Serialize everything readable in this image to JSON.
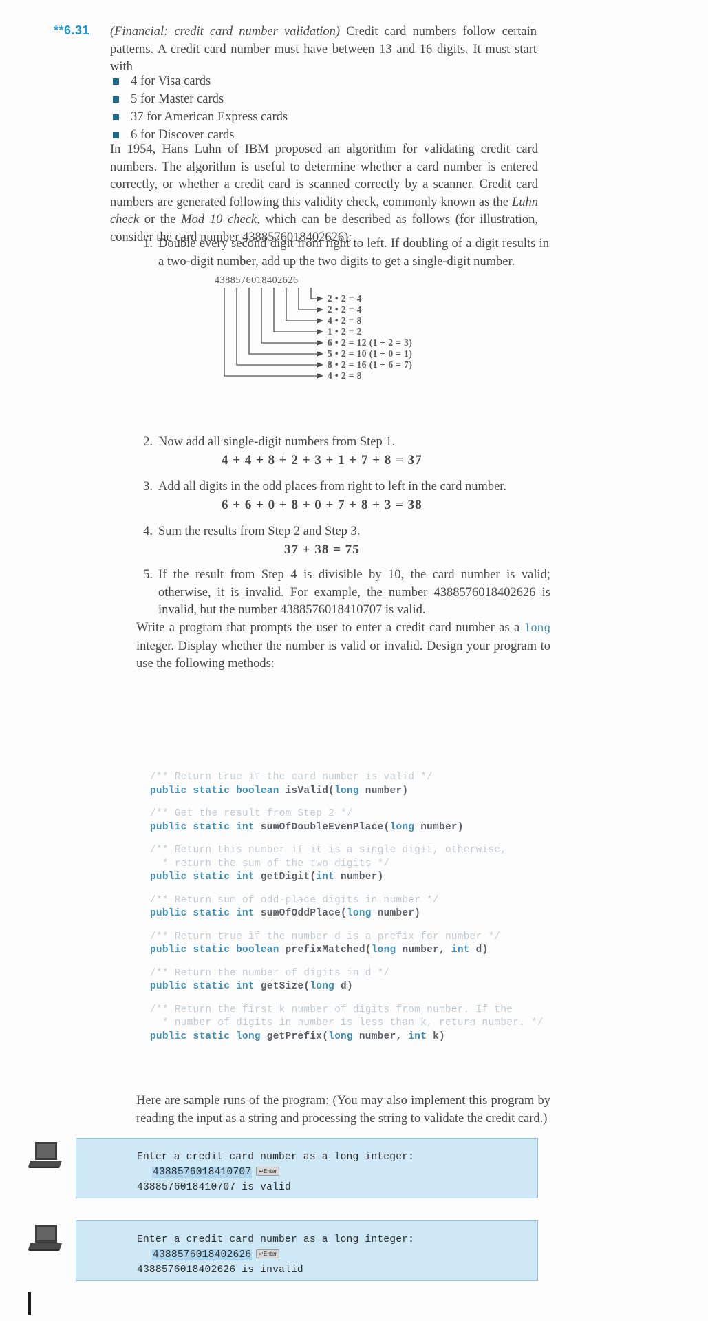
{
  "exercise": {
    "number": "**6.31",
    "title_italic": "(Financial: credit card number validation)",
    "intro": " Credit card numbers follow certain patterns. A credit card number must have between 13 and 16 digits. It must start with",
    "bullets": [
      "4 for Visa cards",
      "5 for Master cards",
      "37 for American Express cards",
      "6 for Discover cards"
    ],
    "paragraph2_a": "In 1954, Hans Luhn of IBM proposed an algorithm for validating credit card numbers. The algorithm is useful to determine whether a card number is entered correctly, or whether a credit card is scanned correctly by a scanner. Credit card numbers are generated following this validity check, commonly known as the ",
    "paragraph2_italic1": "Luhn check",
    "paragraph2_b": " or the ",
    "paragraph2_italic2": "Mod 10 check,",
    "paragraph2_c": " which can be described as follows (for illustration, consider the card number 4388576018402626):"
  },
  "steps": [
    {
      "number": "1.",
      "text": "Double every second digit from right to left. If doubling of a digit results in a two-digit number, add up the two digits to get a single-digit number."
    },
    {
      "number": "2.",
      "text": "Now add all single-digit numbers from Step 1.",
      "equation": "4 + 4 + 8 + 2 + 3 + 1 + 7 + 8 = 37"
    },
    {
      "number": "3.",
      "text": "Add all digits in the odd places from right to left in the card number.",
      "equation": "6 + 6 + 0 + 8 + 0 + 7 + 8 + 3 = 38"
    },
    {
      "number": "4.",
      "text": "Sum the results from Step 2 and Step 3.",
      "equation": "37 + 38 = 75"
    },
    {
      "number": "5.",
      "text": "If the result from Step 4 is divisible by 10, the card number is valid; otherwise, it is invalid. For example, the number 4388576018402626 is invalid, but the number 4388576018410707 is valid."
    }
  ],
  "diagram": {
    "card_number": "4388576018402626",
    "rows": [
      "2 • 2 = 4",
      "2 • 2 = 4",
      "4 • 2 = 8",
      "1 • 2 = 2",
      "6 • 2 = 12  (1 + 2 = 3)",
      "5 • 2 = 10  (1 + 0 = 1)",
      "8 • 2 = 16  (1 + 6 = 7)",
      "4 • 2 = 8"
    ]
  },
  "write_program": {
    "a": "Write a program that prompts the user to enter a credit card number as a ",
    "keyword": "long",
    "b": " integer. Display whether the number is valid or invalid. Design your program to use the following methods:"
  },
  "code": [
    {
      "comment": "/** Return true if the card number is valid */",
      "signature": [
        {
          "t": "public static boolean ",
          "k": true
        },
        {
          "t": "isValid(",
          "k": false
        },
        {
          "t": "long ",
          "k": true
        },
        {
          "t": "number)",
          "k": false
        }
      ]
    },
    {
      "comment": "/** Get the result from Step 2 */",
      "signature": [
        {
          "t": "public static int ",
          "k": true
        },
        {
          "t": "sumOfDoubleEvenPlace(",
          "k": false
        },
        {
          "t": "long ",
          "k": true
        },
        {
          "t": "number)",
          "k": false
        }
      ]
    },
    {
      "comment": "/** Return this number if it is a single digit, otherwise,\n  * return the sum of the two digits */",
      "signature": [
        {
          "t": "public static int ",
          "k": true
        },
        {
          "t": "getDigit(",
          "k": false
        },
        {
          "t": "int ",
          "k": true
        },
        {
          "t": "number)",
          "k": false
        }
      ]
    },
    {
      "comment": "/** Return sum of odd-place digits in number */",
      "signature": [
        {
          "t": "public static int ",
          "k": true
        },
        {
          "t": "sumOfOddPlace(",
          "k": false
        },
        {
          "t": "long ",
          "k": true
        },
        {
          "t": "number)",
          "k": false
        }
      ]
    },
    {
      "comment": "/** Return true if the number d is a prefix for number */",
      "signature": [
        {
          "t": "public static boolean ",
          "k": true
        },
        {
          "t": "prefixMatched(",
          "k": false
        },
        {
          "t": "long ",
          "k": true
        },
        {
          "t": "number, ",
          "k": false
        },
        {
          "t": "int ",
          "k": true
        },
        {
          "t": "d)",
          "k": false
        }
      ]
    },
    {
      "comment": "/** Return the number of digits in d */",
      "signature": [
        {
          "t": "public static int ",
          "k": true
        },
        {
          "t": "getSize(",
          "k": false
        },
        {
          "t": "long ",
          "k": true
        },
        {
          "t": "d)",
          "k": false
        }
      ]
    },
    {
      "comment": "/** Return the first k number of digits from number. If the\n  * number of digits in number is less than k, return number. */",
      "signature": [
        {
          "t": "public static long ",
          "k": true
        },
        {
          "t": "getPrefix(",
          "k": false
        },
        {
          "t": "long ",
          "k": true
        },
        {
          "t": "number, ",
          "k": false
        },
        {
          "t": "int ",
          "k": true
        },
        {
          "t": "k)",
          "k": false
        }
      ]
    }
  ],
  "sample_intro": "Here are sample runs of the program: (You may also implement this program by reading the input as a string and processing the string to validate the credit card.)",
  "runs": [
    {
      "prompt": "Enter a credit card number as a long integer:",
      "input": "4388576018410707",
      "enter_key": "↵Enter",
      "result": "4388576018410707 is valid"
    },
    {
      "prompt": "Enter a credit card number as a long integer:",
      "input": "4388576018402626",
      "enter_key": "↵Enter",
      "result": "4388576018402626 is invalid"
    }
  ],
  "colors": {
    "exercise_number": "#1b9ad6",
    "bullet_square": "#1b6a8c",
    "code_keyword": "#3f8fb8",
    "runbox_bg": "#cfe8f5",
    "runbox_border": "#8fc2dd",
    "highlight": "#aed6ee"
  }
}
